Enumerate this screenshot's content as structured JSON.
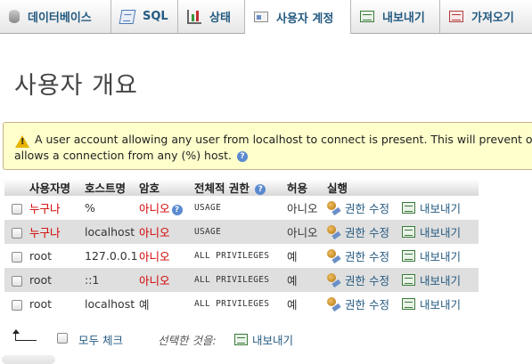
{
  "tabs": [
    {
      "label": "데이터베이스",
      "icon": "database-icon"
    },
    {
      "label": "SQL",
      "icon": "sql-icon"
    },
    {
      "label": "상태",
      "icon": "status-icon"
    },
    {
      "label": "사용자 계정",
      "icon": "users-icon",
      "active": true
    },
    {
      "label": "내보내기",
      "icon": "export-icon"
    },
    {
      "label": "가져오기",
      "icon": "import-icon"
    }
  ],
  "page_title": "사용자 개요",
  "notice": {
    "line1": "A user account allowing any user from localhost to connect is present. This will prevent oth",
    "line2": "allows a connection from any (%) host."
  },
  "table": {
    "headers": {
      "user": "사용자명",
      "host": "호스트명",
      "password": "암호",
      "global_privileges": "전체적 권한",
      "grant": "허용",
      "action": "실행"
    },
    "rows": [
      {
        "user": "누구나",
        "host": "%",
        "password": "아니오",
        "privileges": "USAGE",
        "grant": "아니오"
      },
      {
        "user": "누구나",
        "host": "localhost",
        "password": "아니오",
        "privileges": "USAGE",
        "grant": "아니오"
      },
      {
        "user": "root",
        "host": "127.0.0.1",
        "password": "아니오",
        "privileges": "ALL PRIVILEGES",
        "grant": "예"
      },
      {
        "user": "root",
        "host": "::1",
        "password": "아니오",
        "privileges": "ALL PRIVILEGES",
        "grant": "예"
      },
      {
        "user": "root",
        "host": "localhost",
        "password": "예",
        "privileges": "ALL PRIVILEGES",
        "grant": "예"
      }
    ],
    "edit_label": "권한 수정",
    "export_label": "내보내기"
  },
  "footer": {
    "check_all": "모두 체크",
    "with_selected": "선택한 것을:",
    "export_label": "내보내기"
  },
  "colors": {
    "link": "#235a81",
    "warning_text": "#d20000",
    "notice_bg": "#ffffcc"
  }
}
